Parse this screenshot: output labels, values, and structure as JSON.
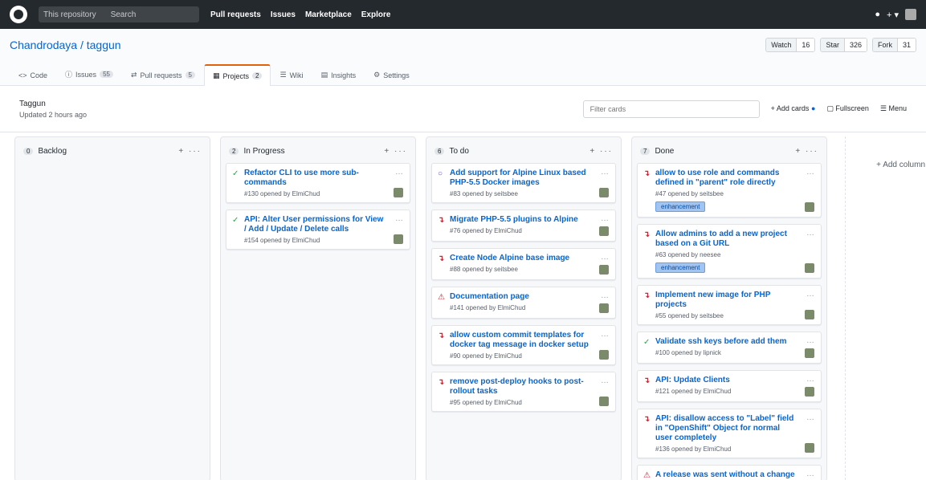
{
  "header": {
    "search_scope": "This repository",
    "search_placeholder": "Search",
    "nav": [
      "Pull requests",
      "Issues",
      "Marketplace",
      "Explore"
    ],
    "right_icons": [
      "bell-icon",
      "plus-icon",
      "avatar"
    ]
  },
  "repo": {
    "title": "Chandrodaya / taggun",
    "watch": {
      "label": "Watch",
      "count": "16"
    },
    "star": {
      "label": "Star",
      "count": "326"
    },
    "fork": {
      "label": "Fork",
      "count": "31"
    },
    "tabs": [
      {
        "label": "Code",
        "badge": ""
      },
      {
        "label": "Issues",
        "badge": "55"
      },
      {
        "label": "Pull requests",
        "badge": "5"
      },
      {
        "label": "Projects",
        "badge": "2"
      },
      {
        "label": "Wiki",
        "badge": ""
      },
      {
        "label": "Insights",
        "badge": ""
      },
      {
        "label": "Settings",
        "badge": ""
      }
    ]
  },
  "project": {
    "name": "Taggun",
    "updated": "Updated 2 hours ago",
    "filter_placeholder": "Filter cards",
    "add_cards": "Add cards",
    "fullscreen": "Fullscreen",
    "menu": "Menu"
  },
  "columns": [
    {
      "name": "Backlog",
      "count": "",
      "cards": []
    },
    {
      "name": "In Progress",
      "count": "",
      "cards": [
        {
          "icon": "open",
          "title": "Refactor CLI to use more sub-commands",
          "meta": "#130 opened by ElmiChud",
          "label": ""
        },
        {
          "icon": "open",
          "title": "API: Alter User permissions for View / Add / Update / Delete calls",
          "meta": "#154 opened by ElmiChud",
          "label": ""
        }
      ]
    },
    {
      "name": "To do",
      "count": "",
      "cards": [
        {
          "icon": "issue",
          "title": "Add support for Alpine Linux based PHP-5.5 Docker images",
          "meta": "#83 opened by seitsbee",
          "label": ""
        },
        {
          "icon": "pr",
          "title": "Migrate PHP-5.5 plugins to Alpine",
          "meta": "#76 opened by ElmiChud",
          "label": ""
        },
        {
          "icon": "pr",
          "title": "Create Node Alpine base image",
          "meta": "#88 opened by seitsbee",
          "label": ""
        },
        {
          "icon": "closed",
          "title": "Documentation page",
          "meta": "#141 opened by ElmiChud",
          "label": ""
        },
        {
          "icon": "pr",
          "title": "allow custom commit templates for docker tag message in docker setup",
          "meta": "#90 opened by ElmiChud",
          "label": ""
        },
        {
          "icon": "pr",
          "title": "remove post-deploy hooks to post-rollout tasks",
          "meta": "#95 opened by ElmiChud",
          "label": ""
        }
      ]
    },
    {
      "name": "Done",
      "count": "",
      "cards": [
        {
          "icon": "pr",
          "title": "allow to use role and commands defined in \"parent\" role directly",
          "meta": "#47 opened by seitsbee",
          "label": "enhancement"
        },
        {
          "icon": "pr",
          "title": "Allow admins to add a new project based on a Git URL",
          "meta": "#63 opened by neesee",
          "label": "enhancement"
        },
        {
          "icon": "pr",
          "title": "Implement new image for PHP projects",
          "meta": "#55 opened by seitsbee",
          "label": ""
        },
        {
          "icon": "open",
          "title": "Validate ssh keys before add them",
          "meta": "#100 opened by lipnick",
          "label": ""
        },
        {
          "icon": "pr",
          "title": "API: Update Clients",
          "meta": "#121 opened by ElmiChud",
          "label": ""
        },
        {
          "icon": "pr",
          "title": "API: disallow access to \"Label\" field in \"OpenShift\" Object for normal user completely",
          "meta": "#136 opened by ElmiChud",
          "label": ""
        },
        {
          "icon": "closed",
          "title": "A release was sent without a change of the original build",
          "meta": "",
          "label": ""
        }
      ]
    }
  ],
  "add_column": "+ Add column"
}
